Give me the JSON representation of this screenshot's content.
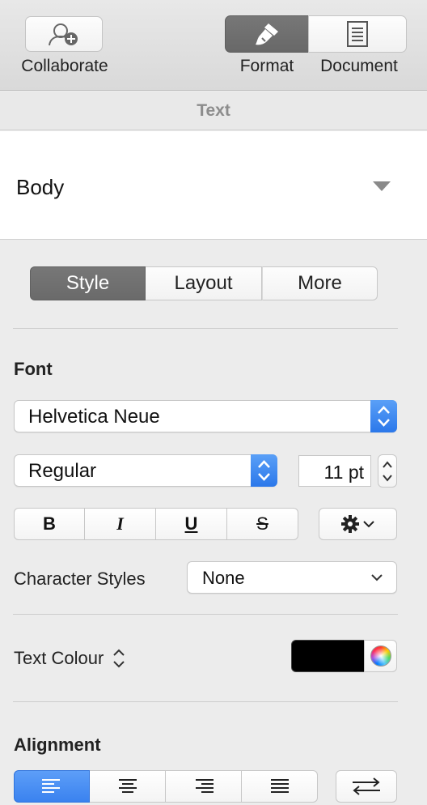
{
  "toolbar": {
    "collaborate_label": "Collaborate",
    "format_label": "Format",
    "document_label": "Document"
  },
  "panel": {
    "header": "Text"
  },
  "paragraph_style": {
    "value": "Body"
  },
  "tabs": [
    {
      "label": "Style",
      "active": true
    },
    {
      "label": "Layout",
      "active": false
    },
    {
      "label": "More",
      "active": false
    }
  ],
  "font": {
    "section_label": "Font",
    "family": "Helvetica Neue",
    "typeface": "Regular",
    "size": "11 pt"
  },
  "formatting": {
    "bold": "B",
    "italic": "I",
    "underline": "U",
    "strikethrough": "S"
  },
  "character_styles": {
    "label": "Character Styles",
    "value": "None"
  },
  "text_colour": {
    "label": "Text Colour",
    "color": "#000000"
  },
  "alignment": {
    "label": "Alignment",
    "selected": "left"
  },
  "colors": {
    "accent_blue": "#3a82ef",
    "toolbar_selected": "#6f6f6f"
  }
}
